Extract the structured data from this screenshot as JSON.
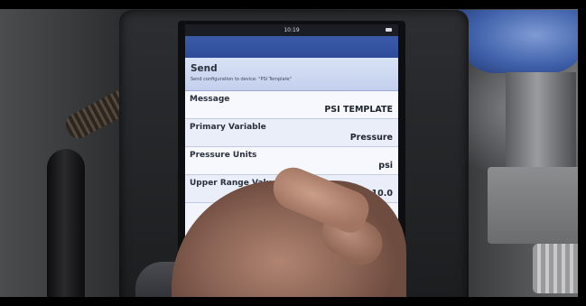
{
  "status_bar": {
    "time": "10:19"
  },
  "header": {
    "title": "Send",
    "subtitle": "Send configuration to device: \"PSI Template\""
  },
  "rows": [
    {
      "label": "Message",
      "value": "PSI TEMPLATE"
    },
    {
      "label": "Primary Variable",
      "value": "Pressure"
    },
    {
      "label": "Pressure Units",
      "value": "psi"
    },
    {
      "label": "Upper Range Value (20 m",
      "value": "10.0"
    }
  ],
  "colors": {
    "title_bar": "#3b5aa8",
    "header_bg": "#d9e2f5",
    "row_bg": "#f6f8fd"
  }
}
